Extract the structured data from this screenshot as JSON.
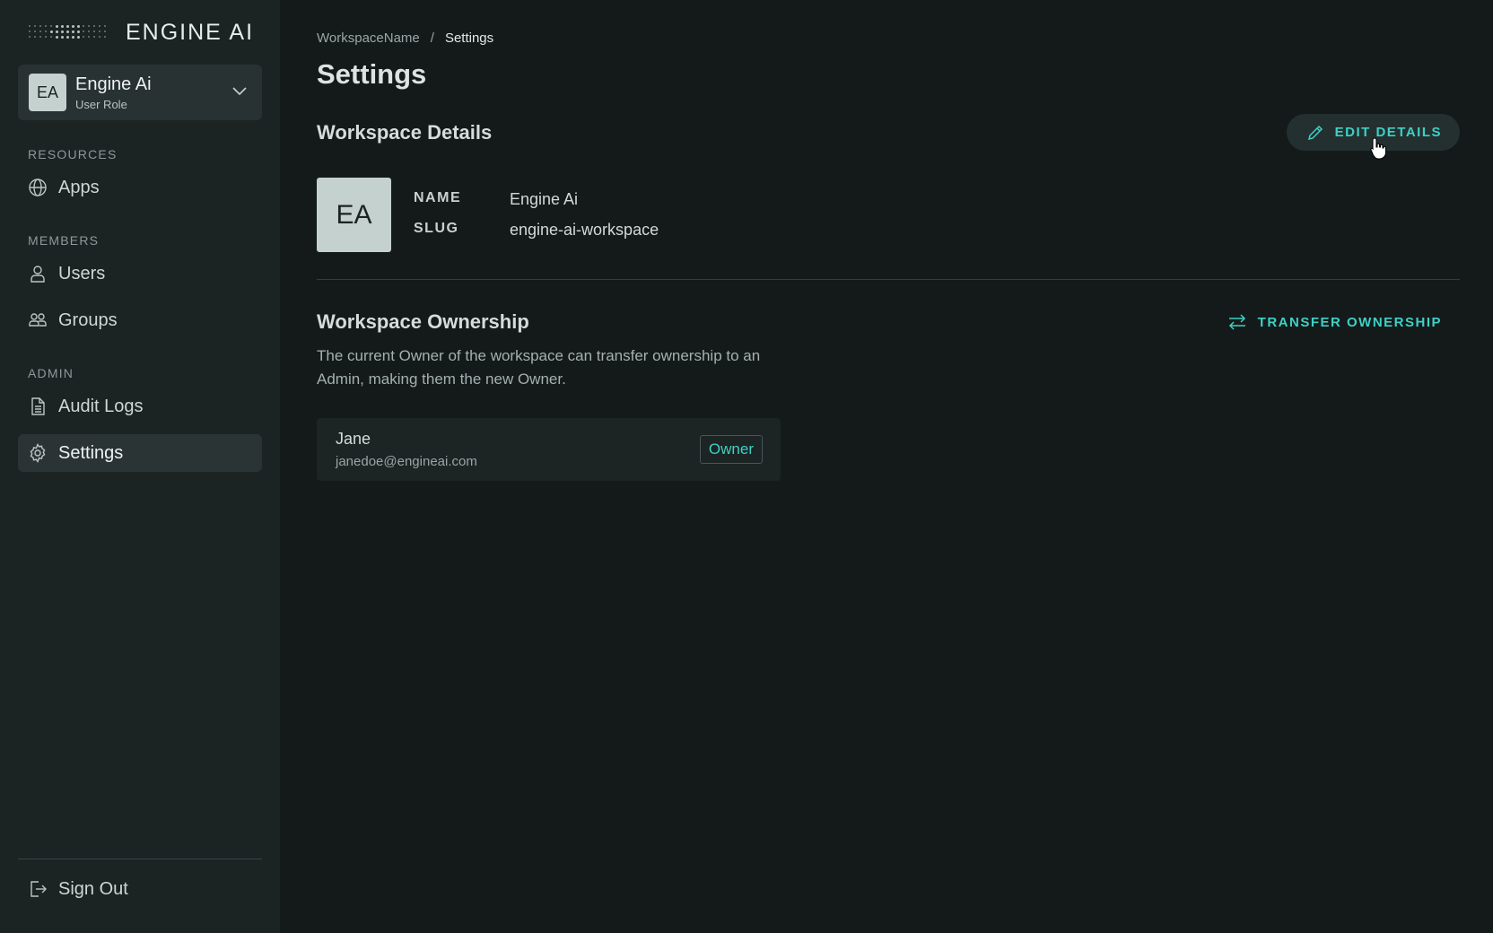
{
  "brand": {
    "name": "ENGINE AI"
  },
  "workspace_switcher": {
    "initials": "EA",
    "name": "Engine Ai",
    "role": "User Role"
  },
  "sidebar": {
    "sections": [
      {
        "label": "RESOURCES",
        "items": [
          {
            "label": "Apps",
            "icon": "globe-icon"
          }
        ]
      },
      {
        "label": "MEMBERS",
        "items": [
          {
            "label": "Users",
            "icon": "user-icon"
          },
          {
            "label": "Groups",
            "icon": "groups-icon"
          }
        ]
      },
      {
        "label": "ADMIN",
        "items": [
          {
            "label": "Audit Logs",
            "icon": "document-icon"
          },
          {
            "label": "Settings",
            "icon": "gear-icon",
            "active": true
          }
        ]
      }
    ],
    "sign_out": "Sign Out"
  },
  "breadcrumb": {
    "workspace": "WorkspaceName",
    "separator": "/",
    "current": "Settings"
  },
  "page": {
    "title": "Settings"
  },
  "details": {
    "heading": "Workspace Details",
    "edit_label": "EDIT DETAILS",
    "initials": "EA",
    "name_key": "NAME",
    "name_value": "Engine Ai",
    "slug_key": "SLUG",
    "slug_value": "engine-ai-workspace"
  },
  "ownership": {
    "heading": "Workspace Ownership",
    "transfer_label": "TRANSFER OWNERSHIP",
    "description": "The current Owner of the workspace can transfer ownership to an Admin, making them the new Owner.",
    "owner": {
      "name": "Jane",
      "email": "janedoe@engineai.com",
      "badge": "Owner"
    }
  },
  "colors": {
    "accent": "#3ed1c5",
    "sidebar_bg": "#1b2323",
    "main_bg": "#141a1a"
  }
}
